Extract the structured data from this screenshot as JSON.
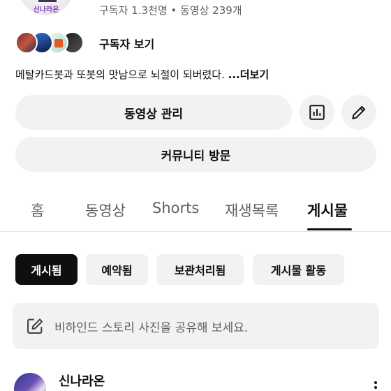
{
  "channel": {
    "avatar_logo_text": "신나라온",
    "stats": "구독자 1.3천명 • 동영상 239개",
    "subscribers_label": "구독자 보기",
    "description": "메탈카드봇과 또봇의 맛남으로 뇌절이 되버렸다. ",
    "description_more": "...더보기"
  },
  "buttons": {
    "manage_videos": "동영상 관리",
    "stats_icon": "bar-chart-icon",
    "edit_icon": "pencil-icon",
    "community": "커뮤니티 방문"
  },
  "tabs": [
    {
      "label": "홈",
      "active": false
    },
    {
      "label": "동영상",
      "active": false
    },
    {
      "label": "Shorts",
      "active": false
    },
    {
      "label": "재생목록",
      "active": false
    },
    {
      "label": "게시물",
      "active": true
    }
  ],
  "filters": [
    {
      "label": "게시됨",
      "active": true
    },
    {
      "label": "예약됨",
      "active": false
    },
    {
      "label": "보관처리됨",
      "active": false
    },
    {
      "label": "게시물 활동",
      "active": false
    }
  ],
  "story_prompt": {
    "icon": "edit-square-icon",
    "text": "비하인드 스토리 사진을 공유해 보세요."
  },
  "post": {
    "author": "신나라온",
    "menu_icon": "more-vert-icon"
  },
  "colors": {
    "chip_active_bg": "#0f0f0f",
    "button_bg": "#f2f2f2",
    "secondary_text": "#606060"
  }
}
